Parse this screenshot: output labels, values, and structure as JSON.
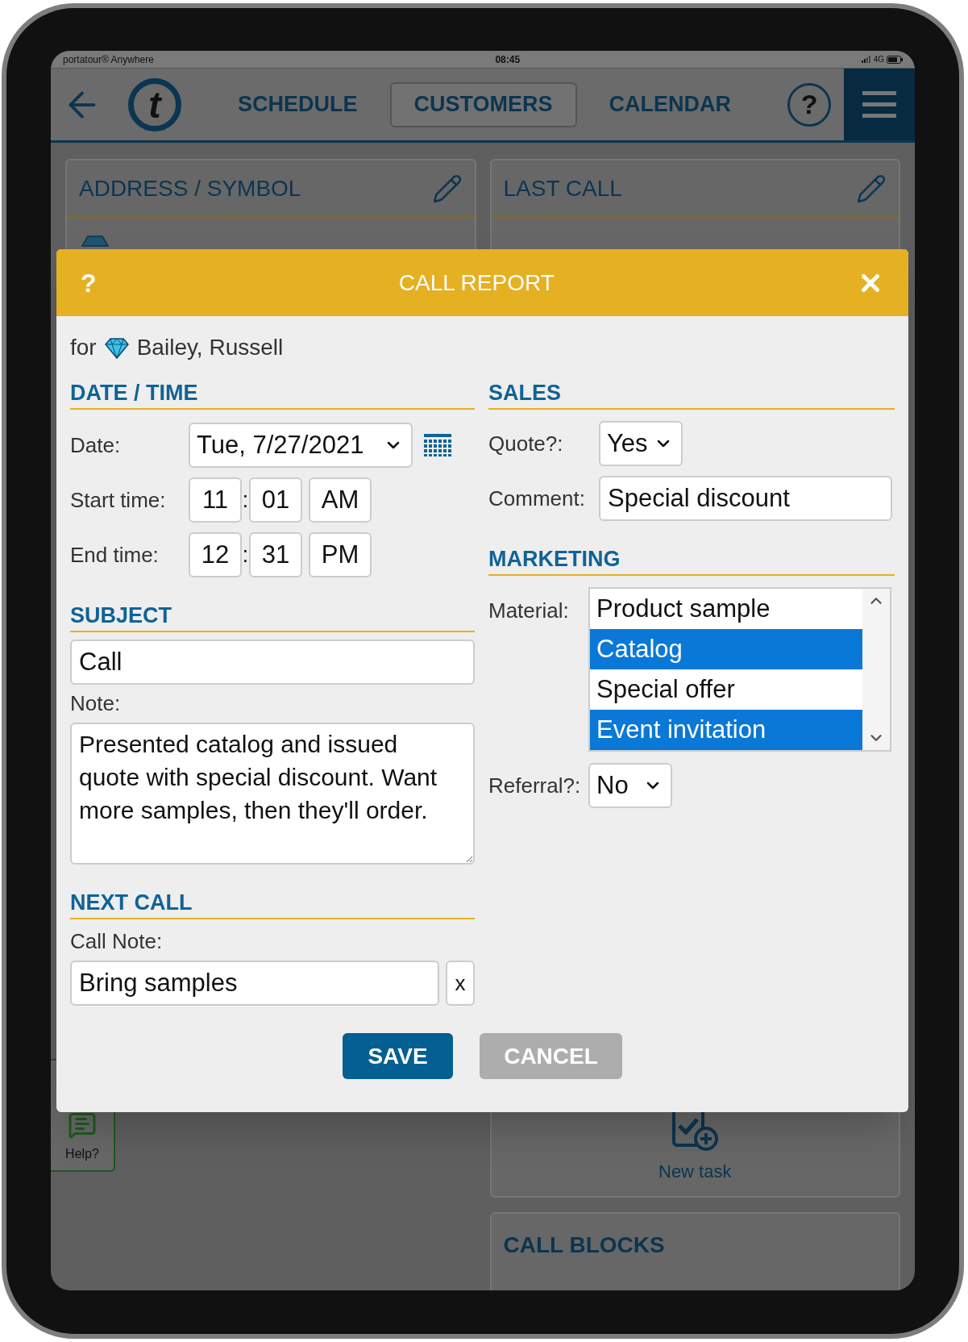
{
  "status_bar": {
    "app": "portatour® Anywhere",
    "time": "08:45",
    "network": "4G"
  },
  "nav": {
    "logo": "t",
    "tabs": [
      {
        "label": "SCHEDULE",
        "selected": false
      },
      {
        "label": "CUSTOMERS",
        "selected": true
      },
      {
        "label": "CALENDAR",
        "selected": false
      }
    ],
    "help": "?"
  },
  "cards": {
    "address": {
      "title": "ADDRESS / SYMBOL"
    },
    "last_call": {
      "title": "LAST CALL"
    },
    "new_task": {
      "label": "New task"
    },
    "call_blocks": {
      "title": "CALL BLOCKS"
    },
    "help_tab": {
      "label": "Help?"
    }
  },
  "dialog": {
    "title": "CALL REPORT",
    "help": "?",
    "for_label": "for",
    "customer": "Bailey, Russell",
    "date_time": {
      "heading": "DATE / TIME",
      "date": {
        "label": "Date:",
        "value": "Tue, 7/27/2021"
      },
      "start": {
        "label": "Start time:",
        "hour": "11",
        "separator": ":",
        "minute": "01",
        "ampm": "AM"
      },
      "end": {
        "label": "End time:",
        "hour": "12",
        "separator": ":",
        "minute": "31",
        "ampm": "PM"
      }
    },
    "subject": {
      "heading": "SUBJECT",
      "value": "Call",
      "note_label": "Note:",
      "note": "Presented catalog and issued quote with special discount. Want more samples, then they'll order."
    },
    "next_call": {
      "heading": "NEXT CALL",
      "call_note_label": "Call Note:",
      "value": "Bring samples",
      "clear": "x"
    },
    "sales": {
      "heading": "SALES",
      "quote": {
        "label": "Quote?:",
        "value": "Yes"
      },
      "comment": {
        "label": "Comment:",
        "value": "Special discount"
      }
    },
    "marketing": {
      "heading": "MARKETING",
      "material": {
        "label": "Material:",
        "options": [
          {
            "label": "Product sample",
            "selected": false
          },
          {
            "label": "Catalog",
            "selected": true
          },
          {
            "label": "Special offer",
            "selected": false
          },
          {
            "label": "Event invitation",
            "selected": true
          }
        ]
      },
      "referral": {
        "label": "Referral?:",
        "value": "No"
      }
    },
    "buttons": {
      "save": "SAVE",
      "cancel": "CANCEL"
    }
  }
}
